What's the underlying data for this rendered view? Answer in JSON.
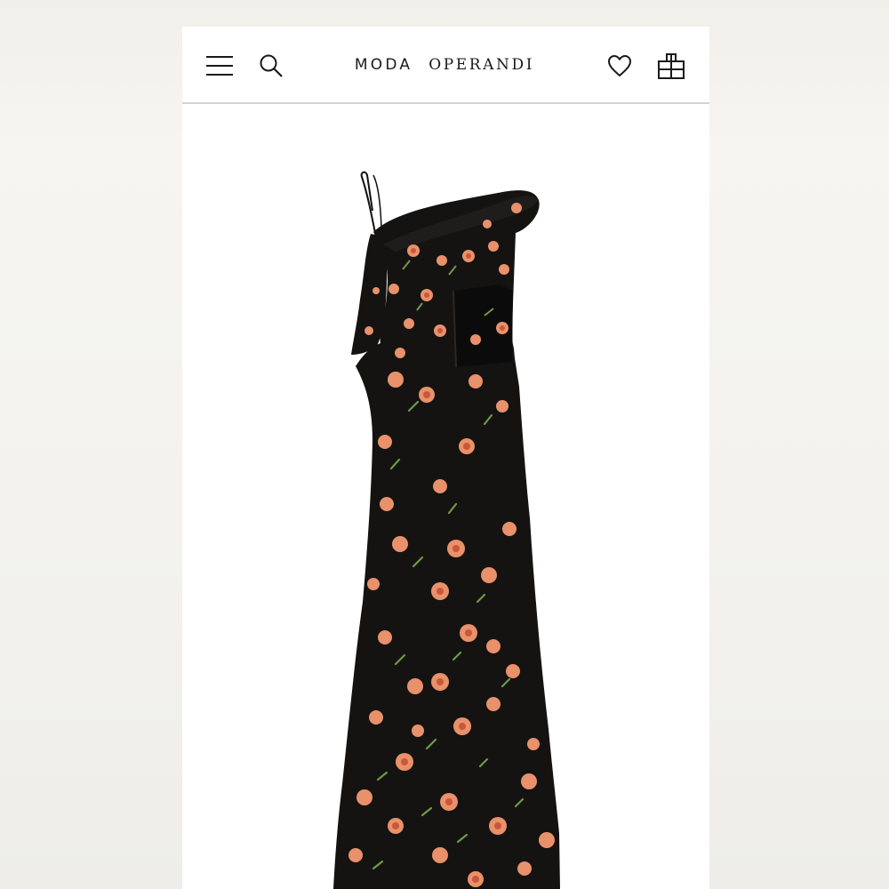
{
  "header": {
    "brand_word_1": "MODA",
    "brand_word_2": "OPERANDI",
    "icons": {
      "menu": "hamburger-menu-icon",
      "search": "search-icon",
      "wishlist": "heart-icon",
      "bag": "shopping-bag-icon"
    }
  },
  "product": {
    "image": "black-floral-one-shoulder-maxi-dress",
    "colors": {
      "fabric": "#141312",
      "rose": "#e9916a",
      "rose_dark": "#c9573a",
      "leaf": "#6f9a47"
    }
  },
  "colors": {
    "background": "#ffffff",
    "text": "#1a1a1a",
    "divider": "#d4d4d4"
  }
}
